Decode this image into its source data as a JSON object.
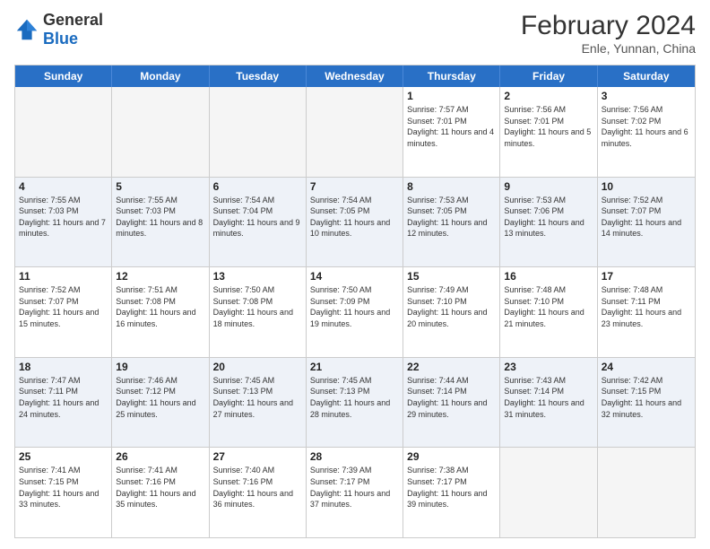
{
  "header": {
    "logo_general": "General",
    "logo_blue": "Blue",
    "month_title": "February 2024",
    "location": "Enle, Yunnan, China"
  },
  "days_of_week": [
    "Sunday",
    "Monday",
    "Tuesday",
    "Wednesday",
    "Thursday",
    "Friday",
    "Saturday"
  ],
  "weeks": [
    [
      {
        "day": "",
        "sunrise": "",
        "sunset": "",
        "daylight": "",
        "empty": true
      },
      {
        "day": "",
        "sunrise": "",
        "sunset": "",
        "daylight": "",
        "empty": true
      },
      {
        "day": "",
        "sunrise": "",
        "sunset": "",
        "daylight": "",
        "empty": true
      },
      {
        "day": "",
        "sunrise": "",
        "sunset": "",
        "daylight": "",
        "empty": true
      },
      {
        "day": "1",
        "sunrise": "Sunrise: 7:57 AM",
        "sunset": "Sunset: 7:01 PM",
        "daylight": "Daylight: 11 hours and 4 minutes."
      },
      {
        "day": "2",
        "sunrise": "Sunrise: 7:56 AM",
        "sunset": "Sunset: 7:01 PM",
        "daylight": "Daylight: 11 hours and 5 minutes."
      },
      {
        "day": "3",
        "sunrise": "Sunrise: 7:56 AM",
        "sunset": "Sunset: 7:02 PM",
        "daylight": "Daylight: 11 hours and 6 minutes."
      }
    ],
    [
      {
        "day": "4",
        "sunrise": "Sunrise: 7:55 AM",
        "sunset": "Sunset: 7:03 PM",
        "daylight": "Daylight: 11 hours and 7 minutes."
      },
      {
        "day": "5",
        "sunrise": "Sunrise: 7:55 AM",
        "sunset": "Sunset: 7:03 PM",
        "daylight": "Daylight: 11 hours and 8 minutes."
      },
      {
        "day": "6",
        "sunrise": "Sunrise: 7:54 AM",
        "sunset": "Sunset: 7:04 PM",
        "daylight": "Daylight: 11 hours and 9 minutes."
      },
      {
        "day": "7",
        "sunrise": "Sunrise: 7:54 AM",
        "sunset": "Sunset: 7:05 PM",
        "daylight": "Daylight: 11 hours and 10 minutes."
      },
      {
        "day": "8",
        "sunrise": "Sunrise: 7:53 AM",
        "sunset": "Sunset: 7:05 PM",
        "daylight": "Daylight: 11 hours and 12 minutes."
      },
      {
        "day": "9",
        "sunrise": "Sunrise: 7:53 AM",
        "sunset": "Sunset: 7:06 PM",
        "daylight": "Daylight: 11 hours and 13 minutes."
      },
      {
        "day": "10",
        "sunrise": "Sunrise: 7:52 AM",
        "sunset": "Sunset: 7:07 PM",
        "daylight": "Daylight: 11 hours and 14 minutes."
      }
    ],
    [
      {
        "day": "11",
        "sunrise": "Sunrise: 7:52 AM",
        "sunset": "Sunset: 7:07 PM",
        "daylight": "Daylight: 11 hours and 15 minutes."
      },
      {
        "day": "12",
        "sunrise": "Sunrise: 7:51 AM",
        "sunset": "Sunset: 7:08 PM",
        "daylight": "Daylight: 11 hours and 16 minutes."
      },
      {
        "day": "13",
        "sunrise": "Sunrise: 7:50 AM",
        "sunset": "Sunset: 7:08 PM",
        "daylight": "Daylight: 11 hours and 18 minutes."
      },
      {
        "day": "14",
        "sunrise": "Sunrise: 7:50 AM",
        "sunset": "Sunset: 7:09 PM",
        "daylight": "Daylight: 11 hours and 19 minutes."
      },
      {
        "day": "15",
        "sunrise": "Sunrise: 7:49 AM",
        "sunset": "Sunset: 7:10 PM",
        "daylight": "Daylight: 11 hours and 20 minutes."
      },
      {
        "day": "16",
        "sunrise": "Sunrise: 7:48 AM",
        "sunset": "Sunset: 7:10 PM",
        "daylight": "Daylight: 11 hours and 21 minutes."
      },
      {
        "day": "17",
        "sunrise": "Sunrise: 7:48 AM",
        "sunset": "Sunset: 7:11 PM",
        "daylight": "Daylight: 11 hours and 23 minutes."
      }
    ],
    [
      {
        "day": "18",
        "sunrise": "Sunrise: 7:47 AM",
        "sunset": "Sunset: 7:11 PM",
        "daylight": "Daylight: 11 hours and 24 minutes."
      },
      {
        "day": "19",
        "sunrise": "Sunrise: 7:46 AM",
        "sunset": "Sunset: 7:12 PM",
        "daylight": "Daylight: 11 hours and 25 minutes."
      },
      {
        "day": "20",
        "sunrise": "Sunrise: 7:45 AM",
        "sunset": "Sunset: 7:13 PM",
        "daylight": "Daylight: 11 hours and 27 minutes."
      },
      {
        "day": "21",
        "sunrise": "Sunrise: 7:45 AM",
        "sunset": "Sunset: 7:13 PM",
        "daylight": "Daylight: 11 hours and 28 minutes."
      },
      {
        "day": "22",
        "sunrise": "Sunrise: 7:44 AM",
        "sunset": "Sunset: 7:14 PM",
        "daylight": "Daylight: 11 hours and 29 minutes."
      },
      {
        "day": "23",
        "sunrise": "Sunrise: 7:43 AM",
        "sunset": "Sunset: 7:14 PM",
        "daylight": "Daylight: 11 hours and 31 minutes."
      },
      {
        "day": "24",
        "sunrise": "Sunrise: 7:42 AM",
        "sunset": "Sunset: 7:15 PM",
        "daylight": "Daylight: 11 hours and 32 minutes."
      }
    ],
    [
      {
        "day": "25",
        "sunrise": "Sunrise: 7:41 AM",
        "sunset": "Sunset: 7:15 PM",
        "daylight": "Daylight: 11 hours and 33 minutes."
      },
      {
        "day": "26",
        "sunrise": "Sunrise: 7:41 AM",
        "sunset": "Sunset: 7:16 PM",
        "daylight": "Daylight: 11 hours and 35 minutes."
      },
      {
        "day": "27",
        "sunrise": "Sunrise: 7:40 AM",
        "sunset": "Sunset: 7:16 PM",
        "daylight": "Daylight: 11 hours and 36 minutes."
      },
      {
        "day": "28",
        "sunrise": "Sunrise: 7:39 AM",
        "sunset": "Sunset: 7:17 PM",
        "daylight": "Daylight: 11 hours and 37 minutes."
      },
      {
        "day": "29",
        "sunrise": "Sunrise: 7:38 AM",
        "sunset": "Sunset: 7:17 PM",
        "daylight": "Daylight: 11 hours and 39 minutes."
      },
      {
        "day": "",
        "sunrise": "",
        "sunset": "",
        "daylight": "",
        "empty": true
      },
      {
        "day": "",
        "sunrise": "",
        "sunset": "",
        "daylight": "",
        "empty": true
      }
    ]
  ],
  "colors": {
    "header_bg": "#2970c6",
    "alt_row_bg": "#eef2f8",
    "empty_bg": "#f5f5f5"
  }
}
